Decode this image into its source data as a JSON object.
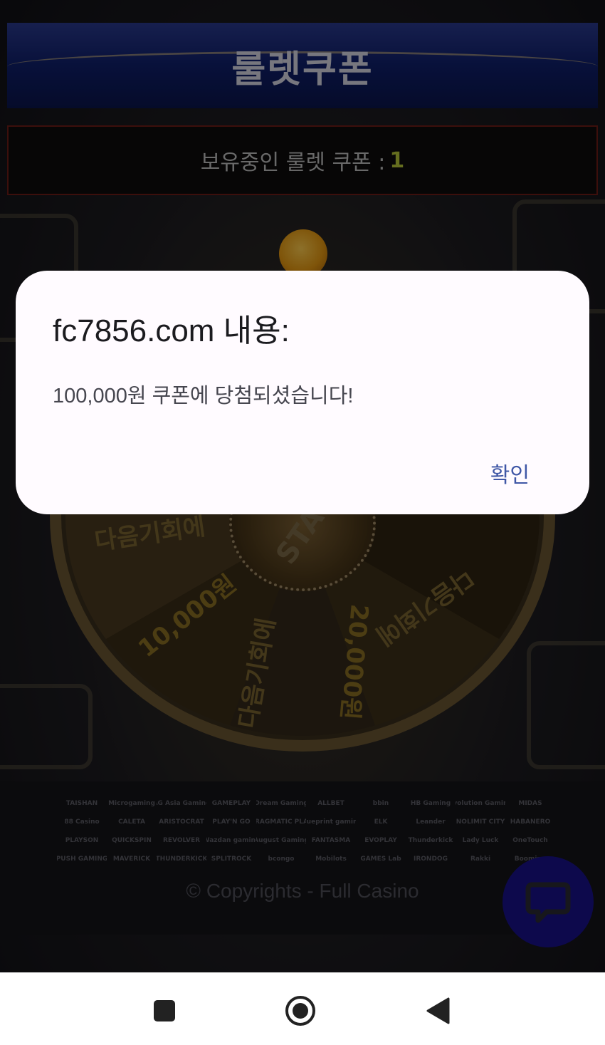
{
  "header": {
    "title": "룰렛쿠폰"
  },
  "coupon_status": {
    "label": "보유중인 룰렛 쿠폰 :",
    "count": "1"
  },
  "wheel": {
    "hub_text": "STA",
    "segments": [
      "다음기회에",
      "10,000원",
      "다음기회에",
      "20,000원",
      "다음기회에"
    ]
  },
  "footer": {
    "providers": [
      "TAISHAN",
      "Microgaming",
      "AG Asia Gaming",
      "GAMEPLAY",
      "Dream Gaming",
      "ALLBET",
      "bbin",
      "HB Gaming",
      "Evolution Gaming",
      "MIDAS",
      "88 Casino",
      "CALETA",
      "ARISTOCRAT",
      "PLAY'N GO",
      "PRAGMATIC PLAY",
      "blueprint gaming",
      "ELK",
      "Leander",
      "NOLIMIT CITY",
      "HABANERO",
      "PLAYSON",
      "QUICKSPIN",
      "REVOLVER",
      "Wazdan gaming",
      "August Gaming",
      "FANTASMA",
      "EVOPLAY",
      "Thunderkick",
      "Lady Luck",
      "OneTouch",
      "PUSH GAMING",
      "MAVERICK",
      "THUNDERKICK",
      "SPLITROCK",
      "bcongo",
      "Mobilots",
      "GAMES Lab",
      "IRONDOG",
      "Rakki",
      "Booming"
    ],
    "copyright": "© Copyrights - Full Casino"
  },
  "dialog": {
    "title": "fc7856.com 내용:",
    "message": "100,000원 쿠폰에 당첨되셨습니다!",
    "ok_label": "확인"
  },
  "colors": {
    "accent_blue": "#3f57a6",
    "coupon_count": "#b8c83a",
    "chat_fab": "#18128a"
  },
  "icons": {
    "chat": "chat-bubble-icon",
    "nav_recents": "square-icon",
    "nav_home": "circle-home-icon",
    "nav_back": "triangle-back-icon"
  }
}
